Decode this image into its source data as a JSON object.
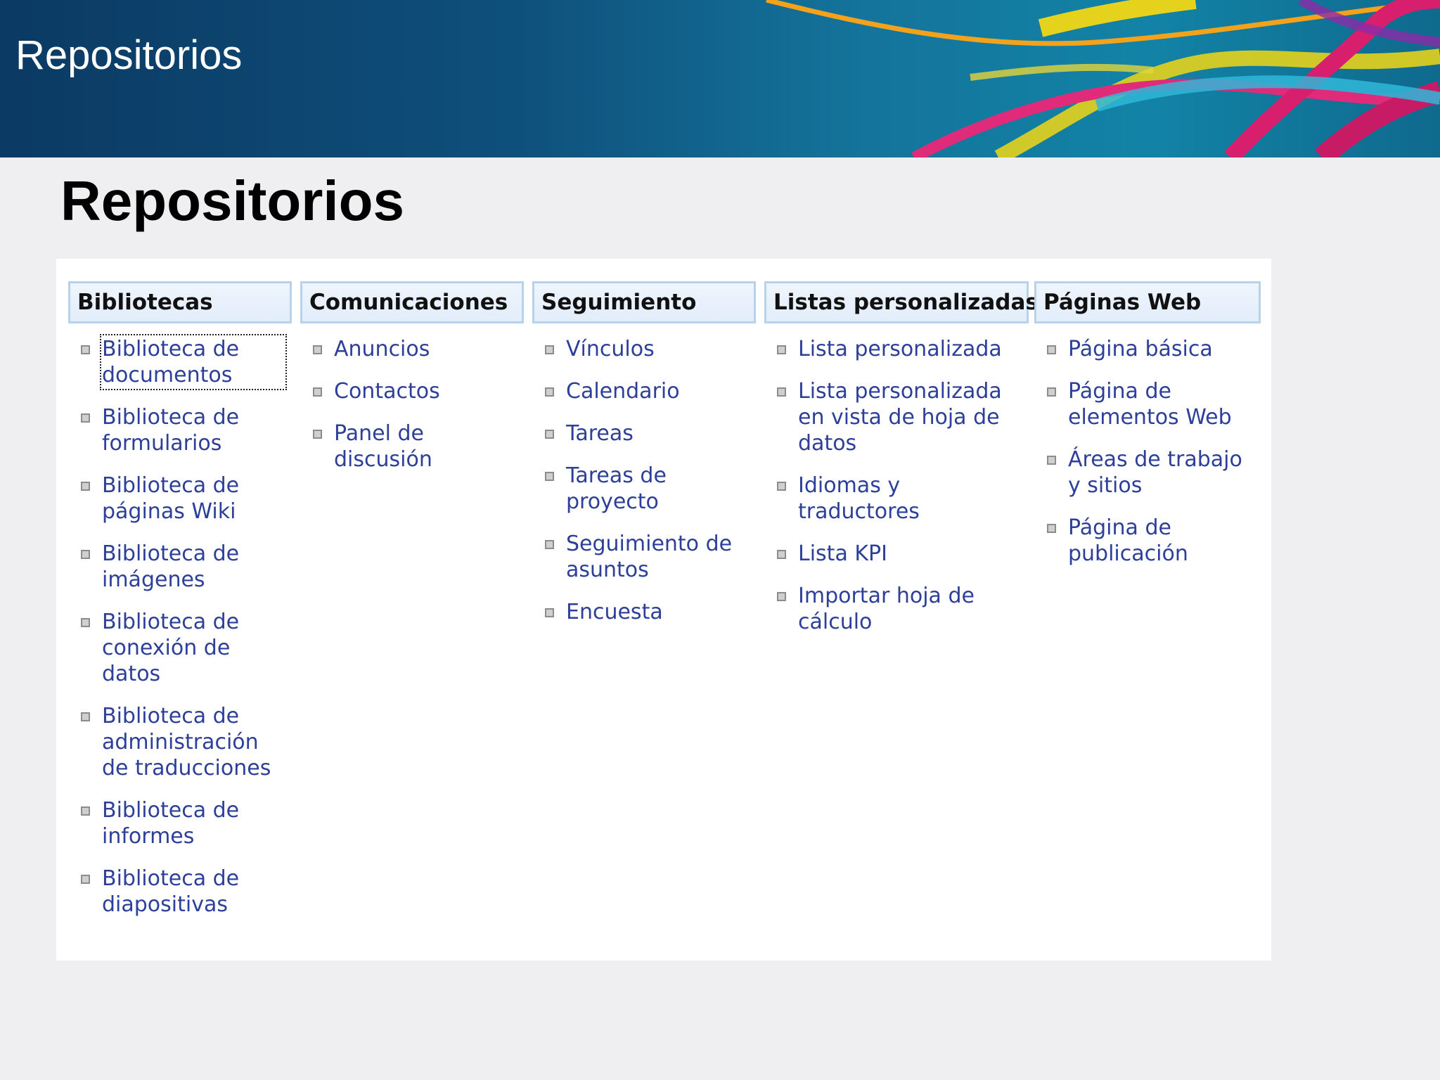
{
  "banner": {
    "title": "Repositorios"
  },
  "page": {
    "heading": "Repositorios"
  },
  "colors": {
    "link": "#2d3f99",
    "header_border": "#b9d2ec",
    "header_bg": "#e9f2fc",
    "banner_bg": "#0e4f7b"
  },
  "columns": [
    {
      "header": "Bibliotecas",
      "items": [
        "Biblioteca de documentos",
        "Biblioteca de formularios",
        "Biblioteca de páginas Wiki",
        "Biblioteca de imágenes",
        "Biblioteca de conexión de datos",
        "Biblioteca de administración de traducciones",
        "Biblioteca de informes",
        "Biblioteca de diapositivas"
      ]
    },
    {
      "header": "Comunicaciones",
      "items": [
        "Anuncios",
        "Contactos",
        "Panel de discusión"
      ]
    },
    {
      "header": "Seguimiento",
      "items": [
        "Vínculos",
        "Calendario",
        "Tareas",
        "Tareas de proyecto",
        "Seguimiento de asuntos",
        "Encuesta"
      ]
    },
    {
      "header": "Listas personalizadas",
      "items": [
        "Lista personalizada",
        "Lista personalizada en vista de hoja de datos",
        "Idiomas y traductores",
        "Lista KPI",
        "Importar hoja de cálculo"
      ]
    },
    {
      "header": "Páginas Web",
      "items": [
        "Página básica",
        "Página de elementos Web",
        "Áreas de trabajo y sitios",
        "Página de publicación"
      ]
    }
  ]
}
